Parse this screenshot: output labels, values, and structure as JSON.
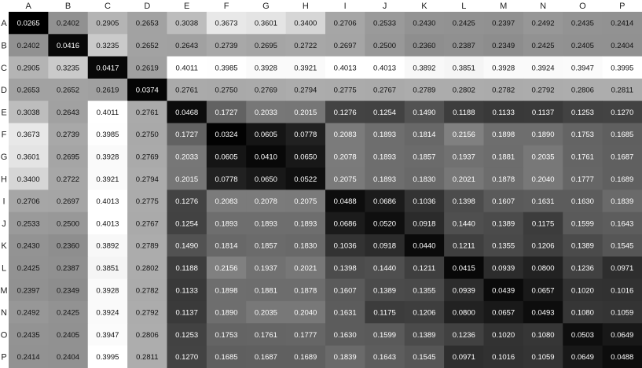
{
  "chart_data": {
    "type": "heatmap",
    "title": "",
    "xlabel": "",
    "ylabel": "",
    "x_labels": [
      "A",
      "B",
      "C",
      "D",
      "E",
      "F",
      "G",
      "H",
      "I",
      "J",
      "K",
      "L",
      "M",
      "N",
      "O",
      "P"
    ],
    "y_labels": [
      "A",
      "B",
      "C",
      "D",
      "E",
      "F",
      "G",
      "H",
      "I",
      "J",
      "K",
      "L",
      "M",
      "N",
      "O",
      "P"
    ],
    "color_scale": {
      "min_color": "#000000",
      "max_color": "#ffffff",
      "vmin": 0.03,
      "vmax": 0.4
    },
    "values": [
      [
        "0.0265",
        "0.2402",
        "0.2905",
        "0.2653",
        "0.3038",
        "0.3673",
        "0.3601",
        "0.3400",
        "0.2706",
        "0.2533",
        "0.2430",
        "0.2425",
        "0.2397",
        "0.2492",
        "0.2435",
        "0.2414"
      ],
      [
        "0.2402",
        "0.0416",
        "0.3235",
        "0.2652",
        "0.2643",
        "0.2739",
        "0.2695",
        "0.2722",
        "0.2697",
        "0.2500",
        "0.2360",
        "0.2387",
        "0.2349",
        "0.2425",
        "0.2405",
        "0.2404"
      ],
      [
        "0.2905",
        "0.3235",
        "0.0417",
        "0.2619",
        "0.4011",
        "0.3985",
        "0.3928",
        "0.3921",
        "0.4013",
        "0.4013",
        "0.3892",
        "0.3851",
        "0.3928",
        "0.3924",
        "0.3947",
        "0.3995"
      ],
      [
        "0.2653",
        "0.2652",
        "0.2619",
        "0.0374",
        "0.2761",
        "0.2750",
        "0.2769",
        "0.2794",
        "0.2775",
        "0.2767",
        "0.2789",
        "0.2802",
        "0.2782",
        "0.2792",
        "0.2806",
        "0.2811"
      ],
      [
        "0.3038",
        "0.2643",
        "0.4011",
        "0.2761",
        "0.0468",
        "0.1727",
        "0.2033",
        "0.2015",
        "0.1276",
        "0.1254",
        "0.1490",
        "0.1188",
        "0.1133",
        "0.1137",
        "0.1253",
        "0.1270"
      ],
      [
        "0.3673",
        "0.2739",
        "0.3985",
        "0.2750",
        "0.1727",
        "0.0324",
        "0.0605",
        "0.0778",
        "0.2083",
        "0.1893",
        "0.1814",
        "0.2156",
        "0.1898",
        "0.1890",
        "0.1753",
        "0.1685"
      ],
      [
        "0.3601",
        "0.2695",
        "0.3928",
        "0.2769",
        "0.2033",
        "0.0605",
        "0.0410",
        "0.0650",
        "0.2078",
        "0.1893",
        "0.1857",
        "0.1937",
        "0.1881",
        "0.2035",
        "0.1761",
        "0.1687"
      ],
      [
        "0.3400",
        "0.2722",
        "0.3921",
        "0.2794",
        "0.2015",
        "0.0778",
        "0.0650",
        "0.0522",
        "0.2075",
        "0.1893",
        "0.1830",
        "0.2021",
        "0.1878",
        "0.2040",
        "0.1777",
        "0.1689"
      ],
      [
        "0.2706",
        "0.2697",
        "0.4013",
        "0.2775",
        "0.1276",
        "0.2083",
        "0.2078",
        "0.2075",
        "0.0488",
        "0.0686",
        "0.1036",
        "0.1398",
        "0.1607",
        "0.1631",
        "0.1630",
        "0.1839"
      ],
      [
        "0.2533",
        "0.2500",
        "0.4013",
        "0.2767",
        "0.1254",
        "0.1893",
        "0.1893",
        "0.1893",
        "0.0686",
        "0.0520",
        "0.0918",
        "0.1440",
        "0.1389",
        "0.1175",
        "0.1599",
        "0.1643"
      ],
      [
        "0.2430",
        "0.2360",
        "0.3892",
        "0.2789",
        "0.1490",
        "0.1814",
        "0.1857",
        "0.1830",
        "0.1036",
        "0.0918",
        "0.0440",
        "0.1211",
        "0.1355",
        "0.1206",
        "0.1389",
        "0.1545"
      ],
      [
        "0.2425",
        "0.2387",
        "0.3851",
        "0.2802",
        "0.1188",
        "0.2156",
        "0.1937",
        "0.2021",
        "0.1398",
        "0.1440",
        "0.1211",
        "0.0415",
        "0.0939",
        "0.0800",
        "0.1236",
        "0.0971"
      ],
      [
        "0.2397",
        "0.2349",
        "0.3928",
        "0.2782",
        "0.1133",
        "0.1898",
        "0.1881",
        "0.1878",
        "0.1607",
        "0.1389",
        "0.1355",
        "0.0939",
        "0.0439",
        "0.0657",
        "0.1020",
        "0.1016"
      ],
      [
        "0.2492",
        "0.2425",
        "0.3924",
        "0.2792",
        "0.1137",
        "0.1890",
        "0.2035",
        "0.2040",
        "0.1631",
        "0.1175",
        "0.1206",
        "0.0800",
        "0.0657",
        "0.0493",
        "0.1080",
        "0.1059"
      ],
      [
        "0.2435",
        "0.2405",
        "0.3947",
        "0.2806",
        "0.1253",
        "0.1753",
        "0.1761",
        "0.1777",
        "0.1630",
        "0.1599",
        "0.1389",
        "0.1236",
        "0.1020",
        "0.1080",
        "0.0503",
        "0.0649"
      ],
      [
        "0.2414",
        "0.2404",
        "0.3995",
        "0.2811",
        "0.1270",
        "0.1685",
        "0.1687",
        "0.1689",
        "0.1839",
        "0.1643",
        "0.1545",
        "0.0971",
        "0.1016",
        "0.1059",
        "0.0649",
        "0.0488"
      ]
    ]
  }
}
